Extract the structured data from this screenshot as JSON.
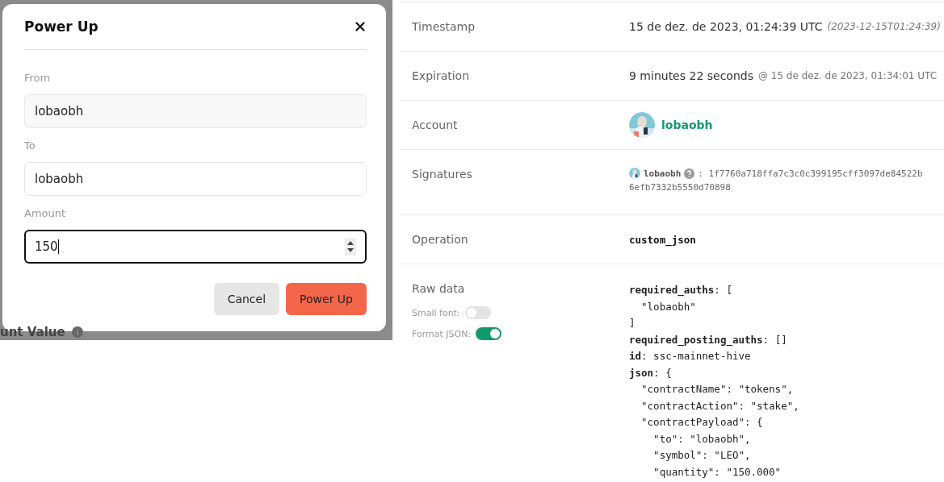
{
  "background": {
    "text": "unt Value"
  },
  "dialog": {
    "title": "Power Up",
    "fields": [
      {
        "label": "From",
        "value": "lobaobh",
        "kind": "readonly"
      },
      {
        "label": "To",
        "value": "lobaobh",
        "kind": "text"
      },
      {
        "label": "Amount",
        "value": "150",
        "kind": "number"
      }
    ],
    "buttons": [
      {
        "label": "Cancel",
        "kind": "secondary"
      },
      {
        "label": "Power Up",
        "kind": "primary"
      }
    ]
  },
  "details": [
    {
      "label": "Timestamp",
      "kind": "time",
      "value": "15 de dez. de 2023, 01:24:39 UTC",
      "note": "(2023-12-15T01:24:39)"
    },
    {
      "label": "Expiration",
      "kind": "expiry",
      "value": "9 minutes 22 seconds",
      "note": "@ 15 de dez. de 2023, 01:34:01 UTC"
    },
    {
      "label": "Account",
      "kind": "account",
      "value": "lobaobh"
    },
    {
      "label": "Signatures",
      "kind": "signature",
      "value": "lobaobh",
      "note": ": 1f7760a718ffa7c3c0c399195cff3097de84522b",
      "note2": "6efb7332b5550d70898"
    },
    {
      "label": "Operation",
      "kind": "code",
      "value": "custom_json"
    }
  ],
  "raw": {
    "label": "Raw data",
    "toggles": [
      {
        "label": "Small font:",
        "on": false
      },
      {
        "label": "Format JSON:",
        "on": true
      }
    ],
    "lines": [
      "**required_auths**: [",
      "  \"lobaobh\"",
      "]",
      "**required_posting_auths**: []",
      "**id**: ssc-mainnet-hive",
      "**json**: {",
      "  \"contractName\": \"tokens\",",
      "  \"contractAction\": \"stake\",",
      "  \"contractPayload\": {",
      "    \"to\": \"lobaobh\",",
      "    \"symbol\": \"LEO\",",
      "    \"quantity\": \"150.000\""
    ]
  }
}
